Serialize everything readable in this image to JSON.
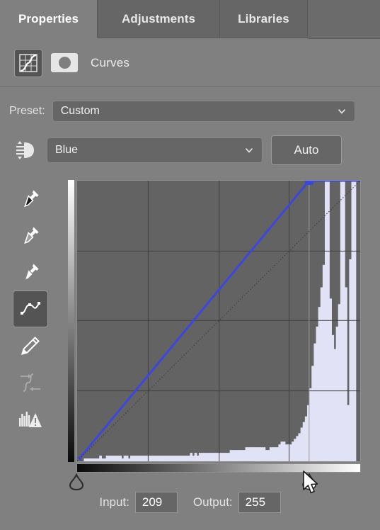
{
  "window": {
    "panel_title": "Properties"
  },
  "tabs": [
    {
      "label": "Properties",
      "active": true
    },
    {
      "label": "Adjustments",
      "active": false
    },
    {
      "label": "Libraries",
      "active": false
    }
  ],
  "header": {
    "adjustment_name": "Curves",
    "layer_icon": "curves-icon",
    "mask_icon": "layer-mask-thumbnail"
  },
  "preset": {
    "label": "Preset:",
    "value": "Custom",
    "chevron": "chevron-down-icon"
  },
  "channel": {
    "value": "Blue",
    "chevron": "chevron-down-icon",
    "auto_label": "Auto",
    "preset_options_icon": "curve-presets-icon"
  },
  "toolbar": {
    "items": [
      {
        "name": "black-point-eyedropper-icon",
        "selected": false
      },
      {
        "name": "gray-point-eyedropper-icon",
        "selected": false
      },
      {
        "name": "white-point-eyedropper-icon",
        "selected": false
      },
      {
        "name": "curve-point-tool-icon",
        "selected": true
      },
      {
        "name": "pencil-draw-curve-icon",
        "selected": false
      },
      {
        "name": "smooth-curve-icon",
        "selected": false,
        "disabled": true
      },
      {
        "name": "histogram-warning-icon",
        "selected": false
      }
    ]
  },
  "fields": {
    "input_label": "Input:",
    "input_value": "209",
    "output_label": "Output:",
    "output_value": "255"
  },
  "sliders": {
    "black_point": 0,
    "white_point": 209
  },
  "colors": {
    "panel_bg": "#808080",
    "tab_inactive": "#666666",
    "plot_bg": "#636363",
    "curve_blue": "#3c47dd",
    "histogram": "#e2e2f7",
    "text": "#ebebeb"
  },
  "chart_data": {
    "type": "line",
    "title": "Curves — Blue channel",
    "xlabel": "Input",
    "ylabel": "Output",
    "xlim": [
      0,
      255
    ],
    "ylim": [
      0,
      255
    ],
    "grid": true,
    "gridlines_x": [
      0,
      64,
      128,
      191,
      255
    ],
    "gridlines_y": [
      0,
      64,
      128,
      191,
      255
    ],
    "legend": "none",
    "series": [
      {
        "name": "Blue curve",
        "type": "line",
        "color": "#3c47dd",
        "points": [
          {
            "input": 0,
            "output": 0,
            "selected": false
          },
          {
            "input": 209,
            "output": 255,
            "selected": true
          },
          {
            "input": 255,
            "output": 255,
            "selected": false
          }
        ]
      },
      {
        "name": "Baseline (identity)",
        "type": "dotted-diagonal",
        "color": "#3a3a3a",
        "points": [
          {
            "input": 0,
            "output": 0
          },
          {
            "input": 255,
            "output": 255
          }
        ]
      }
    ],
    "histogram": {
      "name": "Blue channel histogram",
      "color": "#e2e2f7",
      "bins": 128,
      "max_normalized": 1.0,
      "values": [
        0.0,
        0.0,
        0.0,
        0.01,
        0.01,
        0.01,
        0.01,
        0.01,
        0.01,
        0.01,
        0.02,
        0.01,
        0.01,
        0.02,
        0.02,
        0.02,
        0.02,
        0.02,
        0.02,
        0.02,
        0.01,
        0.02,
        0.02,
        0.01,
        0.02,
        0.02,
        0.02,
        0.02,
        0.02,
        0.02,
        0.02,
        0.02,
        0.02,
        0.02,
        0.02,
        0.02,
        0.02,
        0.02,
        0.02,
        0.02,
        0.02,
        0.02,
        0.02,
        0.02,
        0.02,
        0.02,
        0.02,
        0.02,
        0.02,
        0.02,
        0.02,
        0.03,
        0.02,
        0.03,
        0.02,
        0.03,
        0.03,
        0.03,
        0.03,
        0.03,
        0.03,
        0.03,
        0.03,
        0.03,
        0.03,
        0.03,
        0.03,
        0.03,
        0.03,
        0.04,
        0.04,
        0.04,
        0.04,
        0.04,
        0.04,
        0.04,
        0.05,
        0.05,
        0.05,
        0.05,
        0.05,
        0.05,
        0.05,
        0.05,
        0.05,
        0.04,
        0.04,
        0.05,
        0.05,
        0.05,
        0.05,
        0.06,
        0.07,
        0.07,
        0.06,
        0.06,
        0.06,
        0.07,
        0.08,
        0.09,
        0.1,
        0.12,
        0.14,
        0.16,
        0.2,
        0.26,
        0.34,
        0.42,
        0.48,
        0.55,
        0.62,
        0.7,
        1.0,
        1.0,
        0.58,
        0.45,
        0.4,
        0.48,
        0.56,
        1.0,
        1.0,
        0.62,
        0.2,
        0.72,
        1.0,
        1.0,
        0.0,
        0.0
      ]
    },
    "clip_marker_x": 209
  }
}
